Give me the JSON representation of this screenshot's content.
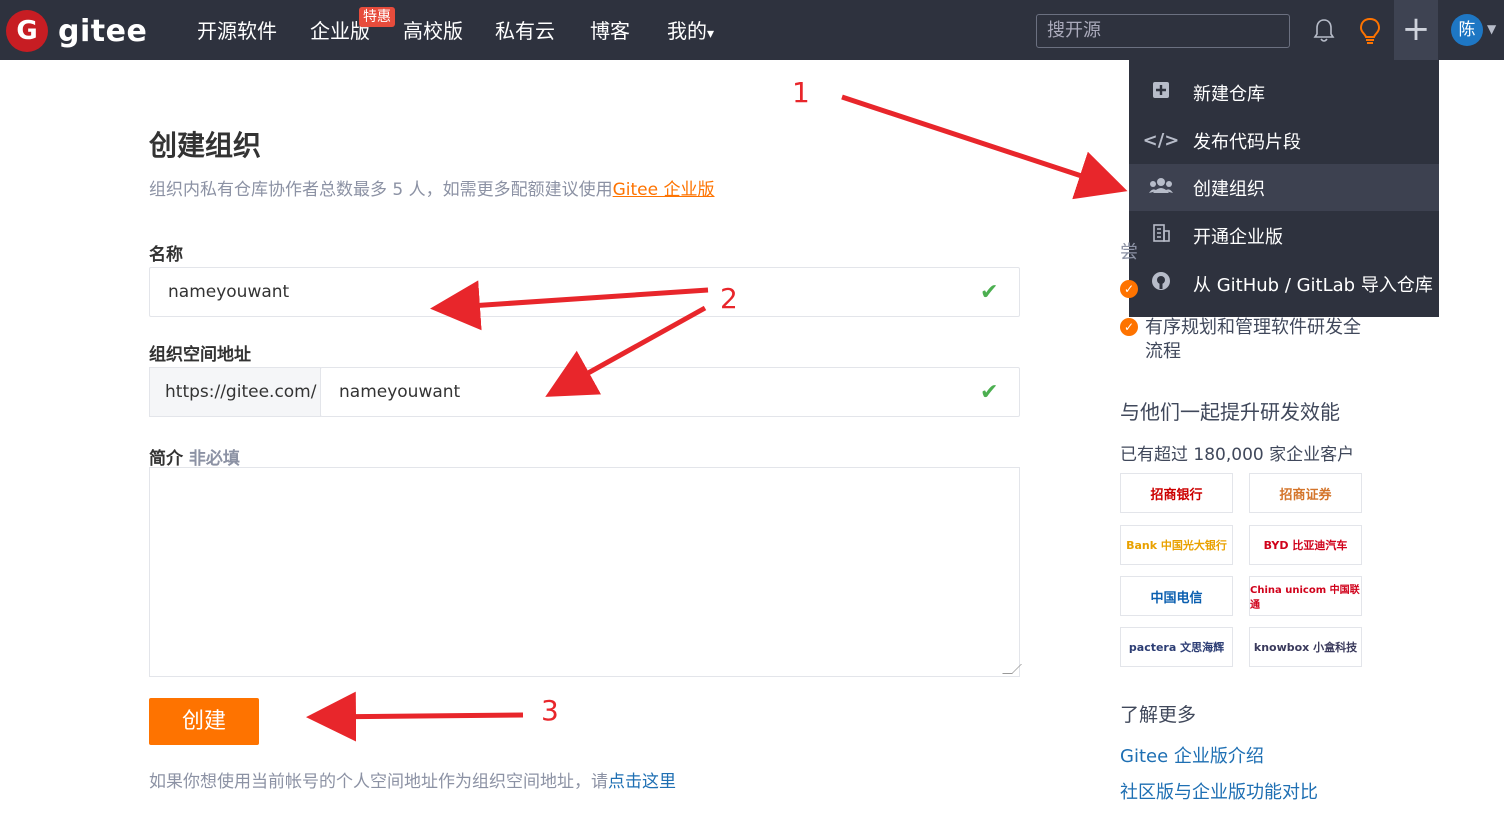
{
  "header": {
    "logo_glyph": "G",
    "logo_text": "gitee",
    "nav": [
      "开源软件",
      "企业版",
      "高校版",
      "私有云",
      "博客",
      "我的"
    ],
    "badge": "特惠",
    "my_caret": "▾",
    "search_placeholder": "搜开源",
    "avatar": "陈"
  },
  "menu": {
    "items": [
      {
        "label": "新建仓库",
        "icon": "plus-square-icon"
      },
      {
        "label": "发布代码片段",
        "icon": "code-icon"
      },
      {
        "label": "创建组织",
        "icon": "users-icon",
        "active": true
      },
      {
        "label": "开通企业版",
        "icon": "building-icon"
      },
      {
        "label": "从 GitHub / GitLab 导入仓库",
        "icon": "github-icon"
      }
    ]
  },
  "form": {
    "title": "创建组织",
    "subtitle": "组织内私有仓库协作者总数最多 5 人，如需更多配额建议使用",
    "subtitle_link": "Gitee 企业版",
    "name_label": "名称",
    "name_value": "nameyouwant",
    "path_label": "组织空间地址",
    "path_prefix": "https://gitee.com/",
    "path_value": "nameyouwant",
    "desc_label": "简介",
    "desc_optional": "非必填",
    "submit": "创建",
    "footnote": "如果你想使用当前帐号的个人空间地址作为组织空间地址，请",
    "footnote_link": "点击这里"
  },
  "sidebar": {
    "partial_char": "尝",
    "benefit": "有序规划和管理软件研发全流程",
    "together": "与他们一起提升研发效能",
    "customers": "已有超过 180,000 家企业客户",
    "logos": [
      "招商银行",
      "招商证券",
      "Bank 中国光大银行",
      "BYD 比亚迪汽车",
      "中国电信",
      "China unicom 中国联通",
      "pactera 文思海辉",
      "knowbox 小盒科技"
    ],
    "learn_more": "了解更多",
    "links": [
      "Gitee 企业版介绍",
      "社区版与企业版功能对比"
    ]
  },
  "annotations": {
    "steps": [
      "1",
      "2",
      "3"
    ],
    "color": "#e8262b"
  },
  "colors": {
    "topbar": "#2e323e",
    "accent": "#fe7300",
    "link": "#1e6fb3",
    "check": "#4caf50"
  }
}
